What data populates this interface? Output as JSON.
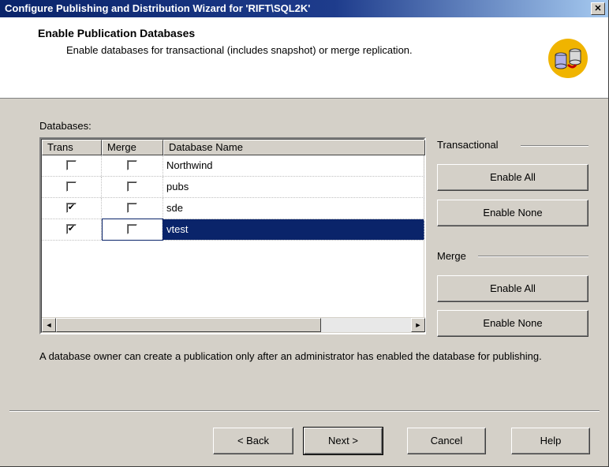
{
  "window": {
    "title": "Configure Publishing and Distribution Wizard for 'RIFT\\SQL2K'",
    "close_glyph": "✕"
  },
  "header": {
    "title": "Enable Publication Databases",
    "subtitle": "Enable databases for transactional (includes snapshot) or merge replication."
  },
  "databases": {
    "label": "Databases:",
    "columns": {
      "trans": "Trans",
      "merge": "Merge",
      "name": "Database Name"
    },
    "rows": [
      {
        "name": "Northwind",
        "trans": false,
        "merge": false
      },
      {
        "name": "pubs",
        "trans": false,
        "merge": false
      },
      {
        "name": "sde",
        "trans": true,
        "merge": false
      },
      {
        "name": "vtest",
        "trans": true,
        "merge": false,
        "selected": true
      }
    ],
    "scroll_left": "◄",
    "scroll_right": "►"
  },
  "transactional": {
    "label": "Transactional",
    "enable_all": "Enable All",
    "enable_none": "Enable None"
  },
  "merge": {
    "label": "Merge",
    "enable_all": "Enable All",
    "enable_none": "Enable None"
  },
  "note": "A database owner can create a publication only after an administrator has enabled the database for publishing.",
  "footer": {
    "back": "< Back",
    "next": "Next >",
    "cancel": "Cancel",
    "help": "Help"
  },
  "check_glyph": "✔"
}
